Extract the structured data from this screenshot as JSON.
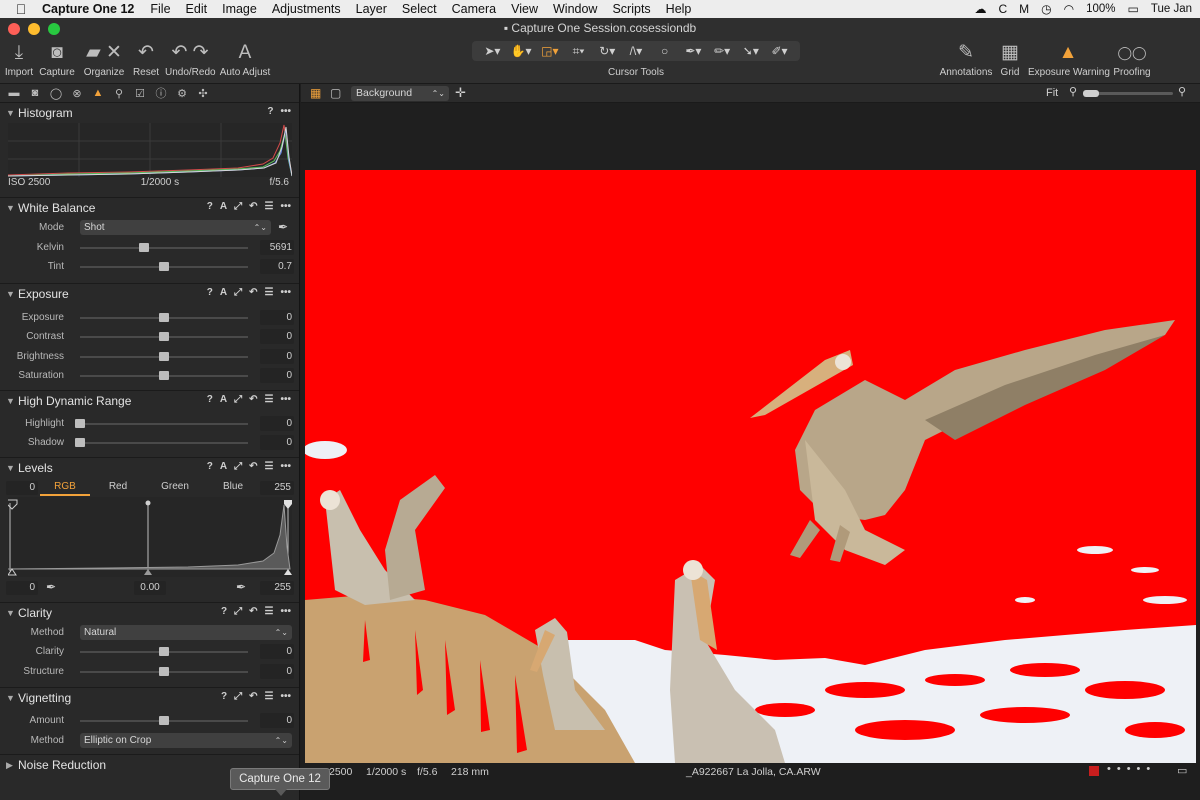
{
  "menubar": {
    "app": "Capture One 12",
    "items": [
      "File",
      "Edit",
      "Image",
      "Adjustments",
      "Layer",
      "Select",
      "Camera",
      "View",
      "Window",
      "Scripts",
      "Help"
    ],
    "battery": "100%",
    "clock": "Tue Jan"
  },
  "window": {
    "title": "Capture One Session.cosessiondb"
  },
  "toolbar": {
    "left": [
      {
        "label": "Import",
        "icon": "import-icon",
        "glyph": "⤓"
      },
      {
        "label": "Capture",
        "icon": "camera-icon",
        "glyph": "◙"
      },
      {
        "label": "Organize",
        "icon": "folder-icon",
        "glyph": "▰"
      },
      {
        "label": "Reset",
        "icon": "reset-icon",
        "glyph": "↶"
      },
      {
        "label": "Undo/Redo",
        "icon": "undo-redo-icon",
        "glyph": "↶ ↷"
      },
      {
        "label": "Auto Adjust",
        "icon": "auto-adjust-icon",
        "glyph": "A"
      }
    ],
    "cursor_tools_label": "Cursor Tools",
    "right": [
      {
        "label": "Annotations",
        "icon": "annotations-icon",
        "glyph": "✎"
      },
      {
        "label": "Grid",
        "icon": "grid-icon",
        "glyph": "▦"
      },
      {
        "label": "Exposure Warning",
        "icon": "warning-icon",
        "glyph": "▲"
      },
      {
        "label": "Proofing",
        "icon": "proofing-glasses-icon",
        "glyph": "◯◯"
      }
    ]
  },
  "viewer_bar": {
    "layer": "Background",
    "zoom": "Fit"
  },
  "tools": {
    "histogram": {
      "title": "Histogram",
      "iso": "ISO 2500",
      "shutter": "1/2000 s",
      "aperture": "f/5.6"
    },
    "white_balance": {
      "title": "White Balance",
      "mode_label": "Mode",
      "mode": "Shot",
      "kelvin_label": "Kelvin",
      "kelvin": "5691",
      "kelvin_pos": 0.38,
      "tint_label": "Tint",
      "tint": "0.7",
      "tint_pos": 0.5
    },
    "exposure": {
      "title": "Exposure",
      "rows": [
        {
          "label": "Exposure",
          "value": "0",
          "pos": 0.5
        },
        {
          "label": "Contrast",
          "value": "0",
          "pos": 0.5
        },
        {
          "label": "Brightness",
          "value": "0",
          "pos": 0.5
        },
        {
          "label": "Saturation",
          "value": "0",
          "pos": 0.5
        }
      ]
    },
    "hdr": {
      "title": "High Dynamic Range",
      "rows": [
        {
          "label": "Highlight",
          "value": "0",
          "pos": 0.0
        },
        {
          "label": "Shadow",
          "value": "0",
          "pos": 0.0
        }
      ]
    },
    "levels": {
      "title": "Levels",
      "input_low": "0",
      "input_high": "255",
      "channels": [
        "RGB",
        "Red",
        "Green",
        "Blue"
      ],
      "active_channel": "RGB",
      "output_low": "0",
      "gamma": "0.00",
      "output_high": "255"
    },
    "clarity": {
      "title": "Clarity",
      "method_label": "Method",
      "method": "Natural",
      "rows": [
        {
          "label": "Clarity",
          "value": "0",
          "pos": 0.5
        },
        {
          "label": "Structure",
          "value": "0",
          "pos": 0.5
        }
      ]
    },
    "vignetting": {
      "title": "Vignetting",
      "amount_label": "Amount",
      "amount": "0",
      "amount_pos": 0.5,
      "method_label": "Method",
      "method": "Elliptic on Crop"
    },
    "noise_reduction": {
      "title": "Noise Reduction"
    }
  },
  "status": {
    "iso": "2500",
    "shutter": "1/2000 s",
    "aperture": "f/5.6",
    "focal": "218 mm",
    "filename": "_A922667 La Jolla, CA.ARW"
  },
  "tooltip": "Capture One 12",
  "colors": {
    "accent": "#f2a23a",
    "overexposure": "#ff0000",
    "panel": "#292929"
  }
}
